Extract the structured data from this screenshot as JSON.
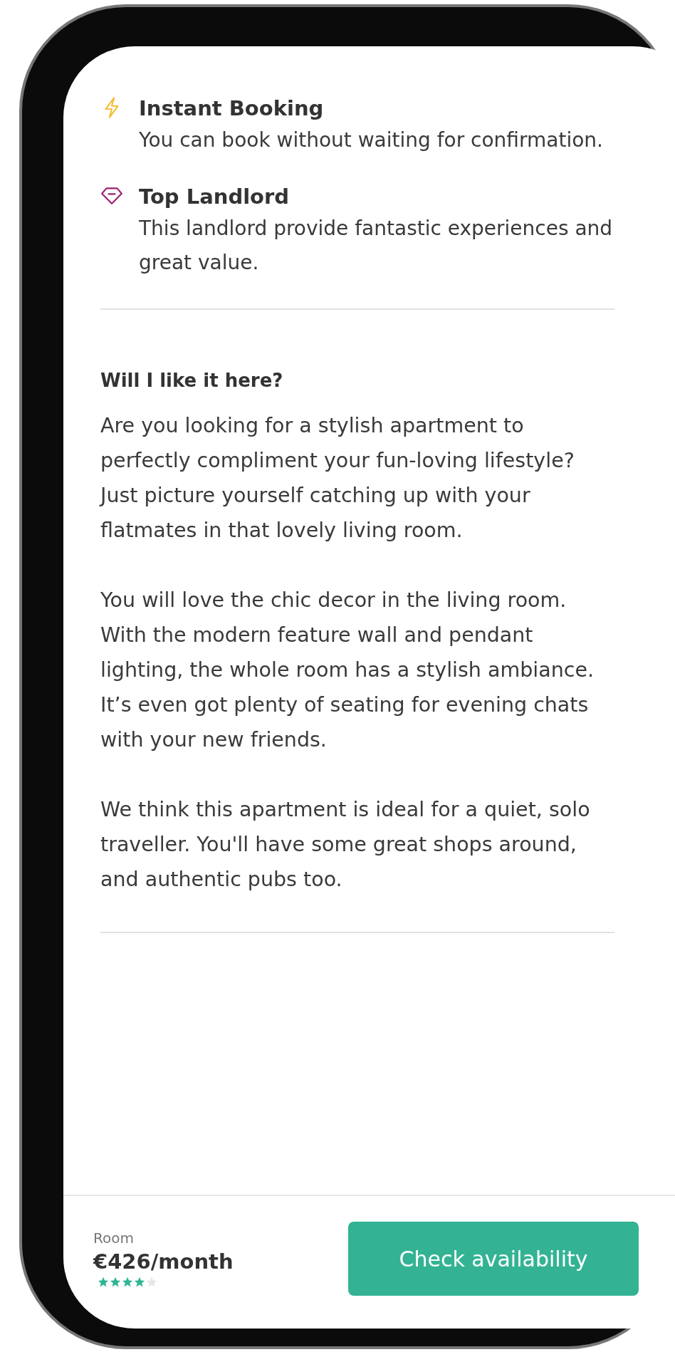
{
  "features": [
    {
      "kind": "instant",
      "title": "Instant Booking",
      "text": "You can book without waiting for confirmation."
    },
    {
      "kind": "top",
      "title": "Top Landlord",
      "text": "This landlord provide fantastic experiences and great value."
    }
  ],
  "section": {
    "heading": "Will I like it here?",
    "paragraphs": [
      "Are you looking for a stylish apartment to perfectly compliment your fun-loving lifestyle? Just picture yourself catching up with your flatmates in that lovely living room.",
      "You will love the chic decor in the living room. With the modern feature wall and pendant lighting, the whole room has a stylish ambiance. It’s even got plenty of seating for evening chats with your new friends.",
      "We think this apartment is ideal for a quiet, solo traveller. You'll have some great shops around, and authentic pubs too."
    ]
  },
  "footer": {
    "type_label": "Room",
    "price": "€426/month",
    "stars": 4,
    "button": "Check availability"
  }
}
